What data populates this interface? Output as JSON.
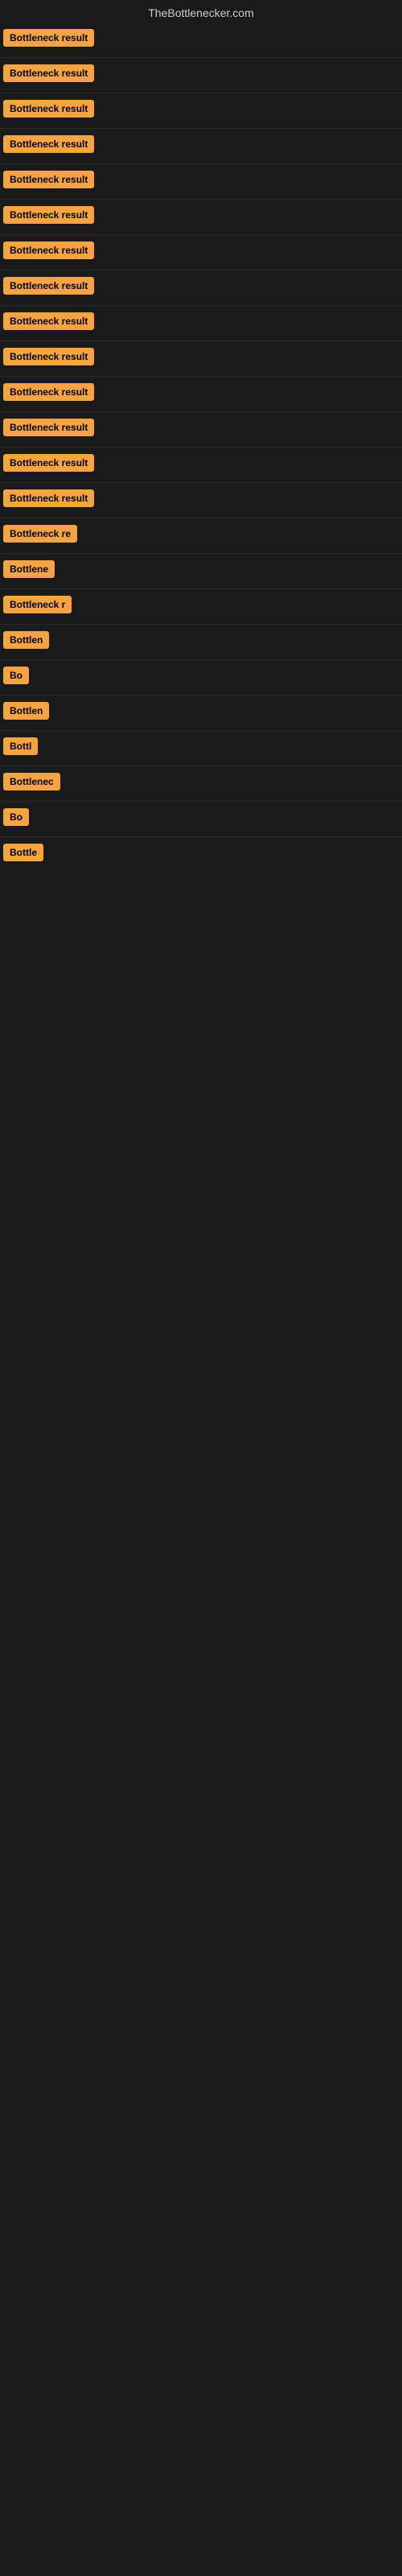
{
  "site": {
    "title": "TheBottlenecker.com"
  },
  "results": [
    {
      "id": 1,
      "label": "Bottleneck result",
      "display": "Bottleneck result"
    },
    {
      "id": 2,
      "label": "Bottleneck result",
      "display": "Bottleneck result"
    },
    {
      "id": 3,
      "label": "Bottleneck result",
      "display": "Bottleneck result"
    },
    {
      "id": 4,
      "label": "Bottleneck result",
      "display": "Bottleneck result"
    },
    {
      "id": 5,
      "label": "Bottleneck result",
      "display": "Bottleneck result"
    },
    {
      "id": 6,
      "label": "Bottleneck result",
      "display": "Bottleneck result"
    },
    {
      "id": 7,
      "label": "Bottleneck result",
      "display": "Bottleneck result"
    },
    {
      "id": 8,
      "label": "Bottleneck result",
      "display": "Bottleneck result"
    },
    {
      "id": 9,
      "label": "Bottleneck result",
      "display": "Bottleneck result"
    },
    {
      "id": 10,
      "label": "Bottleneck result",
      "display": "Bottleneck result"
    },
    {
      "id": 11,
      "label": "Bottleneck result",
      "display": "Bottleneck result"
    },
    {
      "id": 12,
      "label": "Bottleneck result",
      "display": "Bottleneck result"
    },
    {
      "id": 13,
      "label": "Bottleneck result",
      "display": "Bottleneck result"
    },
    {
      "id": 14,
      "label": "Bottleneck result",
      "display": "Bottleneck result"
    },
    {
      "id": 15,
      "label": "Bottleneck result",
      "display": "Bottleneck re"
    },
    {
      "id": 16,
      "label": "Bottleneck result",
      "display": "Bottlene"
    },
    {
      "id": 17,
      "label": "Bottleneck result",
      "display": "Bottleneck r"
    },
    {
      "id": 18,
      "label": "Bottleneck result",
      "display": "Bottlen"
    },
    {
      "id": 19,
      "label": "Bottleneck result",
      "display": "Bo"
    },
    {
      "id": 20,
      "label": "Bottleneck result",
      "display": "Bottlen"
    },
    {
      "id": 21,
      "label": "Bottleneck result",
      "display": "Bottl"
    },
    {
      "id": 22,
      "label": "Bottleneck result",
      "display": "Bottlenec"
    },
    {
      "id": 23,
      "label": "Bottleneck result",
      "display": "Bo"
    },
    {
      "id": 24,
      "label": "Bottleneck result",
      "display": "Bottle"
    }
  ]
}
